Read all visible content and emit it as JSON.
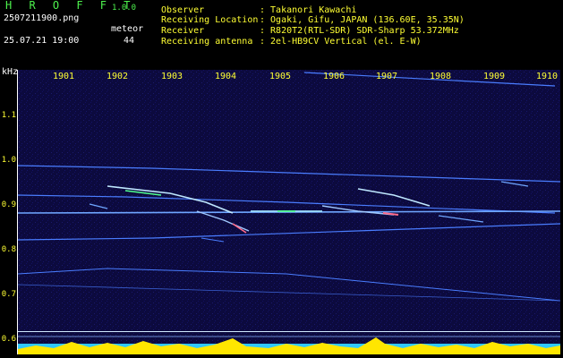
{
  "header": {
    "app_title": "H R O F F T",
    "version": "1.0.0",
    "filename": "2507211900.png",
    "datetime": "25.07.21 19:00",
    "meteor_label": "meteor",
    "meteor_count": "44"
  },
  "info": {
    "observer_label": "Observer",
    "observer_value": ": Takanori Kawachi",
    "location_label": "Receiving Location",
    "location_value": ": Ogaki, Gifu, JAPAN (136.60E, 35.35N)",
    "receiver_label": "Receiver",
    "receiver_value": ": R820T2(RTL-SDR) SDR-Sharp 53.372MHz",
    "antenna_label": "Receiving antenna",
    "antenna_value": ": 2el-HB9CV Vertical (el. E-W)"
  },
  "axis": {
    "unit": "kHz",
    "y_ticks": [
      "1.1",
      "1.0",
      "0.9",
      "0.8",
      "0.7",
      "0.6"
    ],
    "x_ticks": [
      "1901",
      "1902",
      "1903",
      "1904",
      "1905",
      "1906",
      "1907",
      "1908",
      "1909",
      "1910"
    ]
  },
  "colors": {
    "background": "#0c0a3e",
    "trace": "#4a7dff",
    "bright": "#bfe8ff",
    "hot": "#ff6a8a",
    "bar": "#ffe600",
    "baseline": "#30c8ff"
  }
}
